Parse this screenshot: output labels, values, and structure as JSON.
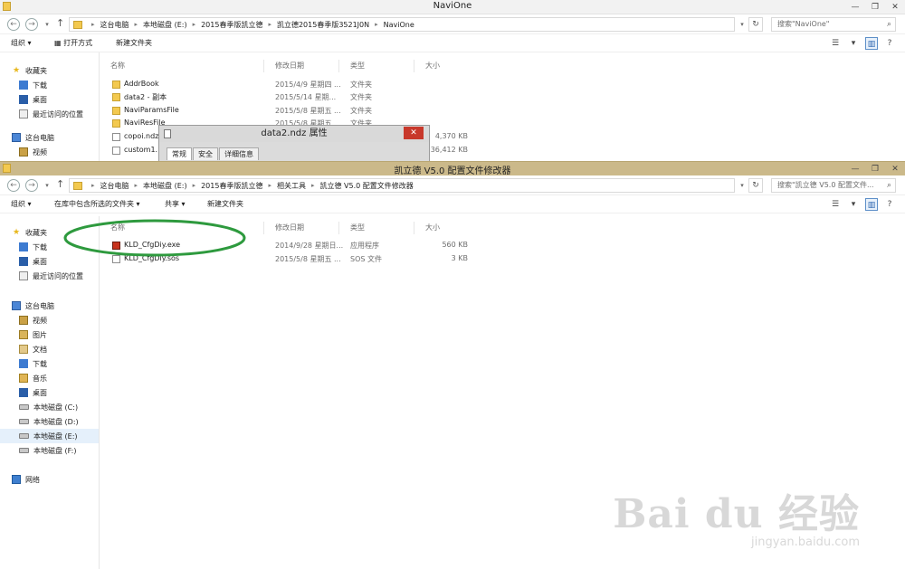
{
  "window_back": {
    "title": "NaviOne",
    "controls": [
      "—",
      "❐",
      "✕"
    ],
    "breadcrumb": [
      "这台电脑",
      "本地磁盘 (E:)",
      "2015春季版凯立德",
      "凯立德2015春季版3521J0N",
      "NaviOne"
    ],
    "search_placeholder": "搜索\"NaviOne\"",
    "toolbar": {
      "organize": "组织 ▾",
      "open_with": "打开方式",
      "new_folder": "新建文件夹"
    },
    "columns": {
      "name": "名称",
      "date": "修改日期",
      "type": "类型",
      "size": "大小"
    },
    "nav": {
      "favorites": "收藏夹",
      "downloads": "下载",
      "desktop": "桌面",
      "recent": "最近访问的位置",
      "this_pc": "这台电脑",
      "videos": "视频"
    },
    "files": [
      {
        "name": "AddrBook",
        "date": "2015/4/9 星期四 ...",
        "type": "文件夹",
        "size": ""
      },
      {
        "name": "data2 - 副本",
        "date": "2015/5/14 星期...",
        "type": "文件夹",
        "size": ""
      },
      {
        "name": "NaviParamsFile",
        "date": "2015/5/8 星期五 ...",
        "type": "文件夹",
        "size": ""
      },
      {
        "name": "NaviResFile",
        "date": "2015/5/8 星期五 ...",
        "type": "文件夹",
        "size": ""
      },
      {
        "name": "copoi.ndz",
        "date": "",
        "type": "",
        "size": "4,370 KB"
      },
      {
        "name": "custom1.",
        "date": "",
        "type": "",
        "size": "36,412 KB"
      }
    ]
  },
  "dialog": {
    "title": "data2.ndz 属性",
    "close": "✕",
    "tabs": [
      "常规",
      "安全",
      "详细信息"
    ]
  },
  "window_front": {
    "title": "凯立德 V5.0 配置文件修改器",
    "controls": [
      "—",
      "❐",
      "✕"
    ],
    "breadcrumb": [
      "这台电脑",
      "本地磁盘 (E:)",
      "2015春季版凯立德",
      "相关工具",
      "凯立德 V5.0 配置文件修改器"
    ],
    "search_placeholder": "搜索\"凯立德 V5.0 配置文件...",
    "toolbar": {
      "organize": "组织 ▾",
      "include": "在库中包含所选的文件夹 ▾",
      "share": "共享 ▾",
      "new_folder": "新建文件夹"
    },
    "columns": {
      "name": "名称",
      "date": "修改日期",
      "type": "类型",
      "size": "大小"
    },
    "nav": {
      "favorites": "收藏夹",
      "downloads": "下载",
      "desktop": "桌面",
      "recent": "最近访问的位置",
      "this_pc": "这台电脑",
      "videos": "视频",
      "pictures": "图片",
      "documents": "文档",
      "downloads2": "下载",
      "music": "音乐",
      "desktop2": "桌面",
      "drive_c": "本地磁盘 (C:)",
      "drive_d": "本地磁盘 (D:)",
      "drive_e": "本地磁盘 (E:)",
      "drive_f": "本地磁盘 (F:)",
      "network": "网络"
    },
    "files": [
      {
        "name": "KLD_CfgDiy.exe",
        "date": "2014/9/28 星期日...",
        "type": "应用程序",
        "size": "560 KB"
      },
      {
        "name": "KLD_CfgDiy.sos",
        "date": "2015/5/8 星期五 ...",
        "type": "SOS 文件",
        "size": "3 KB"
      }
    ],
    "highlight_color": "#2e9a3e"
  },
  "watermark": {
    "main": "Bai du 经验",
    "sub": "jingyan.baidu.com"
  }
}
